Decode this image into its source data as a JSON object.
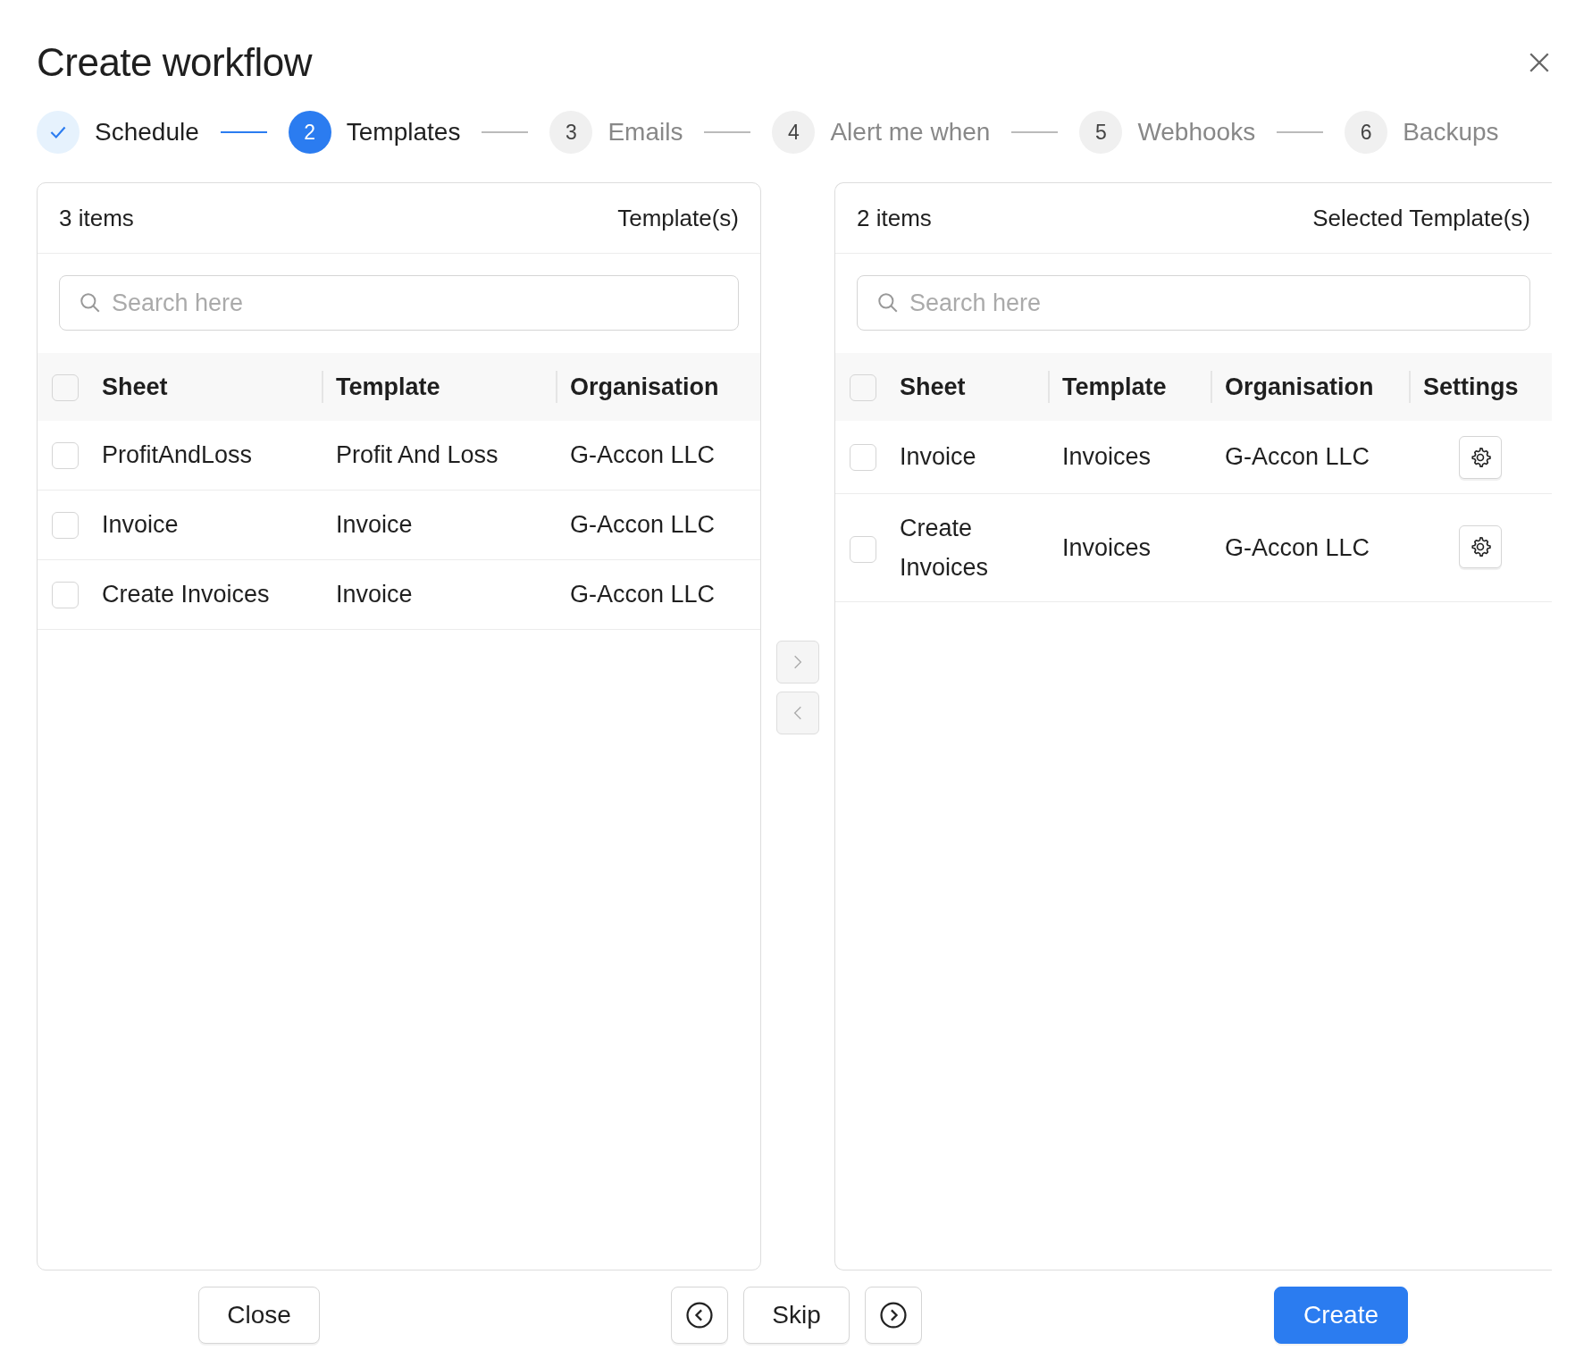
{
  "dialog": {
    "title": "Create workflow"
  },
  "steps": [
    {
      "label": "Schedule",
      "kind": "done"
    },
    {
      "number": "2",
      "label": "Templates",
      "kind": "active"
    },
    {
      "number": "3",
      "label": "Emails",
      "kind": "pending"
    },
    {
      "number": "4",
      "label": "Alert me when",
      "kind": "pending"
    },
    {
      "number": "5",
      "label": "Webhooks",
      "kind": "pending"
    },
    {
      "number": "6",
      "label": "Backups",
      "kind": "pending"
    }
  ],
  "source_panel": {
    "count": "3 items",
    "title": "Template(s)",
    "search": {
      "placeholder": "Search here"
    },
    "select_all": {
      "checked": false
    },
    "columns": [
      "Sheet",
      "Template",
      "Organisation"
    ],
    "rows": [
      {
        "checked": false,
        "cells": [
          "ProfitAndLoss",
          "Profit And Loss",
          "G-Accon LLC"
        ]
      },
      {
        "checked": false,
        "cells": [
          "Invoice",
          "Invoice",
          "G-Accon LLC"
        ]
      },
      {
        "checked": false,
        "cells": [
          "Create Invoices",
          "Invoice",
          "G-Accon LLC"
        ]
      }
    ]
  },
  "target_panel": {
    "count": "2 items",
    "title": "Selected Template(s)",
    "search": {
      "placeholder": "Search here"
    },
    "select_all": {
      "checked": false
    },
    "columns": [
      "Sheet",
      "Template",
      "Organisation",
      "Settings"
    ],
    "rows": [
      {
        "checked": false,
        "cells": [
          "Invoice",
          "Invoices",
          "G-Accon LLC"
        ]
      },
      {
        "checked": false,
        "cells": [
          "Create Invoices",
          "Invoices",
          "G-Accon LLC"
        ]
      }
    ]
  },
  "footer": {
    "close": "Close",
    "skip": "Skip",
    "create": "Create"
  }
}
